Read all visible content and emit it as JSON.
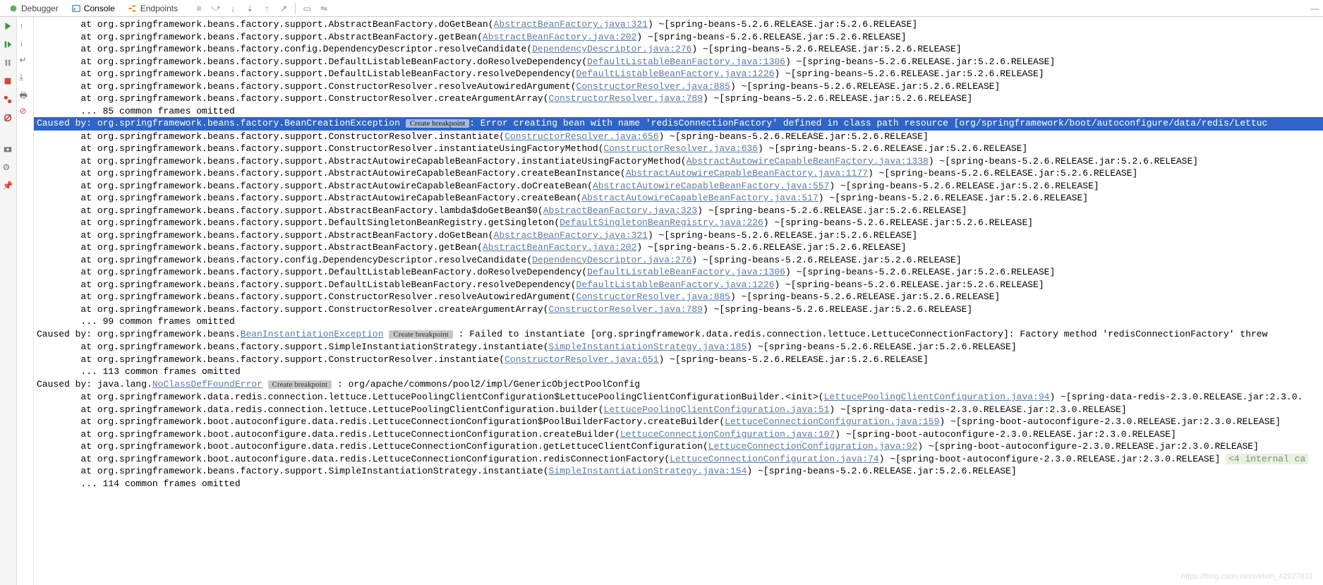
{
  "tabs": {
    "debugger": "Debugger",
    "console": "Console",
    "endpoints": "Endpoints"
  },
  "breakpoint_label": "Create breakpoint",
  "lines": [
    {
      "pre": "        at org.springframework.beans.factory.support.AbstractBeanFactory.doGetBean(",
      "link": "AbstractBeanFactory.java:321",
      "post": ") ~[spring-beans-5.2.6.RELEASE.jar:5.2.6.RELEASE]"
    },
    {
      "pre": "        at org.springframework.beans.factory.support.AbstractBeanFactory.getBean(",
      "link": "AbstractBeanFactory.java:202",
      "post": ") ~[spring-beans-5.2.6.RELEASE.jar:5.2.6.RELEASE]"
    },
    {
      "pre": "        at org.springframework.beans.factory.config.DependencyDescriptor.resolveCandidate(",
      "link": "DependencyDescriptor.java:276",
      "post": ") ~[spring-beans-5.2.6.RELEASE.jar:5.2.6.RELEASE]"
    },
    {
      "pre": "        at org.springframework.beans.factory.support.DefaultListableBeanFactory.doResolveDependency(",
      "link": "DefaultListableBeanFactory.java:1306",
      "post": ") ~[spring-beans-5.2.6.RELEASE.jar:5.2.6.RELEASE]"
    },
    {
      "pre": "        at org.springframework.beans.factory.support.DefaultListableBeanFactory.resolveDependency(",
      "link": "DefaultListableBeanFactory.java:1226",
      "post": ") ~[spring-beans-5.2.6.RELEASE.jar:5.2.6.RELEASE]"
    },
    {
      "pre": "        at org.springframework.beans.factory.support.ConstructorResolver.resolveAutowiredArgument(",
      "link": "ConstructorResolver.java:885",
      "post": ") ~[spring-beans-5.2.6.RELEASE.jar:5.2.6.RELEASE]"
    },
    {
      "pre": "        at org.springframework.beans.factory.support.ConstructorResolver.createArgumentArray(",
      "link": "ConstructorResolver.java:789",
      "post": ") ~[spring-beans-5.2.6.RELEASE.jar:5.2.6.RELEASE]"
    },
    {
      "plain": "        ... 85 common frames omitted"
    },
    {
      "hl": true,
      "pre": "Caused by: org.springframework.beans.factory.BeanCreationException",
      "bp": true,
      "post2": ": Error creating bean with name 'redisConnectionFactory' defined in class path resource [org/springframework/boot/autoconfigure/data/redis/Lettuc"
    },
    {
      "pre": "        at org.springframework.beans.factory.support.ConstructorResolver.instantiate(",
      "link": "ConstructorResolver.java:656",
      "post": ") ~[spring-beans-5.2.6.RELEASE.jar:5.2.6.RELEASE]"
    },
    {
      "pre": "        at org.springframework.beans.factory.support.ConstructorResolver.instantiateUsingFactoryMethod(",
      "link": "ConstructorResolver.java:636",
      "post": ") ~[spring-beans-5.2.6.RELEASE.jar:5.2.6.RELEASE]"
    },
    {
      "pre": "        at org.springframework.beans.factory.support.AbstractAutowireCapableBeanFactory.instantiateUsingFactoryMethod(",
      "link": "AbstractAutowireCapableBeanFactory.java:1338",
      "post": ") ~[spring-beans-5.2.6.RELEASE.jar:5.2.6.RELEASE]"
    },
    {
      "pre": "        at org.springframework.beans.factory.support.AbstractAutowireCapableBeanFactory.createBeanInstance(",
      "link": "AbstractAutowireCapableBeanFactory.java:1177",
      "post": ") ~[spring-beans-5.2.6.RELEASE.jar:5.2.6.RELEASE]"
    },
    {
      "pre": "        at org.springframework.beans.factory.support.AbstractAutowireCapableBeanFactory.doCreateBean(",
      "link": "AbstractAutowireCapableBeanFactory.java:557",
      "post": ") ~[spring-beans-5.2.6.RELEASE.jar:5.2.6.RELEASE]"
    },
    {
      "pre": "        at org.springframework.beans.factory.support.AbstractAutowireCapableBeanFactory.createBean(",
      "link": "AbstractAutowireCapableBeanFactory.java:517",
      "post": ") ~[spring-beans-5.2.6.RELEASE.jar:5.2.6.RELEASE]"
    },
    {
      "pre": "        at org.springframework.beans.factory.support.AbstractBeanFactory.lambda$doGetBean$0(",
      "link": "AbstractBeanFactory.java:323",
      "post": ") ~[spring-beans-5.2.6.RELEASE.jar:5.2.6.RELEASE]"
    },
    {
      "pre": "        at org.springframework.beans.factory.support.DefaultSingletonBeanRegistry.getSingleton(",
      "link": "DefaultSingletonBeanRegistry.java:226",
      "post": ") ~[spring-beans-5.2.6.RELEASE.jar:5.2.6.RELEASE]"
    },
    {
      "pre": "        at org.springframework.beans.factory.support.AbstractBeanFactory.doGetBean(",
      "link": "AbstractBeanFactory.java:321",
      "post": ") ~[spring-beans-5.2.6.RELEASE.jar:5.2.6.RELEASE]"
    },
    {
      "pre": "        at org.springframework.beans.factory.support.AbstractBeanFactory.getBean(",
      "link": "AbstractBeanFactory.java:202",
      "post": ") ~[spring-beans-5.2.6.RELEASE.jar:5.2.6.RELEASE]"
    },
    {
      "pre": "        at org.springframework.beans.factory.config.DependencyDescriptor.resolveCandidate(",
      "link": "DependencyDescriptor.java:276",
      "post": ") ~[spring-beans-5.2.6.RELEASE.jar:5.2.6.RELEASE]"
    },
    {
      "pre": "        at org.springframework.beans.factory.support.DefaultListableBeanFactory.doResolveDependency(",
      "link": "DefaultListableBeanFactory.java:1306",
      "post": ") ~[spring-beans-5.2.6.RELEASE.jar:5.2.6.RELEASE]"
    },
    {
      "pre": "        at org.springframework.beans.factory.support.DefaultListableBeanFactory.resolveDependency(",
      "link": "DefaultListableBeanFactory.java:1226",
      "post": ") ~[spring-beans-5.2.6.RELEASE.jar:5.2.6.RELEASE]"
    },
    {
      "pre": "        at org.springframework.beans.factory.support.ConstructorResolver.resolveAutowiredArgument(",
      "link": "ConstructorResolver.java:885",
      "post": ") ~[spring-beans-5.2.6.RELEASE.jar:5.2.6.RELEASE]"
    },
    {
      "pre": "        at org.springframework.beans.factory.support.ConstructorResolver.createArgumentArray(",
      "link": "ConstructorResolver.java:789",
      "post": ") ~[spring-beans-5.2.6.RELEASE.jar:5.2.6.RELEASE]"
    },
    {
      "plain": "        ... 99 common frames omitted"
    },
    {
      "pre": "Caused by: org.springframework.beans.",
      "link": "BeanInstantiationException",
      "bp": true,
      "post2": " : Failed to instantiate [org.springframework.data.redis.connection.lettuce.LettuceConnectionFactory]: Factory method 'redisConnectionFactory' threw"
    },
    {
      "pre": "        at org.springframework.beans.factory.support.SimpleInstantiationStrategy.instantiate(",
      "link": "SimpleInstantiationStrategy.java:185",
      "post": ") ~[spring-beans-5.2.6.RELEASE.jar:5.2.6.RELEASE]"
    },
    {
      "pre": "        at org.springframework.beans.factory.support.ConstructorResolver.instantiate(",
      "link": "ConstructorResolver.java:651",
      "post": ") ~[spring-beans-5.2.6.RELEASE.jar:5.2.6.RELEASE]"
    },
    {
      "plain": "        ... 113 common frames omitted"
    },
    {
      "pre": "Caused by: java.lang.",
      "link": "NoClassDefFoundError",
      "bp": true,
      "post2": " : org/apache/commons/pool2/impl/GenericObjectPoolConfig"
    },
    {
      "pre": "        at org.springframework.data.redis.connection.lettuce.LettucePoolingClientConfiguration$LettucePoolingClientConfigurationBuilder.<init>(",
      "link": "LettucePoolingClientConfiguration.java:94",
      "post": ") ~[spring-data-redis-2.3.0.RELEASE.jar:2.3.0."
    },
    {
      "pre": "        at org.springframework.data.redis.connection.lettuce.LettucePoolingClientConfiguration.builder(",
      "link": "LettucePoolingClientConfiguration.java:51",
      "post": ") ~[spring-data-redis-2.3.0.RELEASE.jar:2.3.0.RELEASE]"
    },
    {
      "pre": "        at org.springframework.boot.autoconfigure.data.redis.LettuceConnectionConfiguration$PoolBuilderFactory.createBuilder(",
      "link": "LettuceConnectionConfiguration.java:159",
      "post": ") ~[spring-boot-autoconfigure-2.3.0.RELEASE.jar:2.3.0.RELEASE]"
    },
    {
      "pre": "        at org.springframework.boot.autoconfigure.data.redis.LettuceConnectionConfiguration.createBuilder(",
      "link": "LettuceConnectionConfiguration.java:107",
      "post": ") ~[spring-boot-autoconfigure-2.3.0.RELEASE.jar:2.3.0.RELEASE]"
    },
    {
      "pre": "        at org.springframework.boot.autoconfigure.data.redis.LettuceConnectionConfiguration.getLettuceClientConfiguration(",
      "link": "LettuceConnectionConfiguration.java:92",
      "post": ") ~[spring-boot-autoconfigure-2.3.0.RELEASE.jar:2.3.0.RELEASE]"
    },
    {
      "pre": "        at org.springframework.boot.autoconfigure.data.redis.LettuceConnectionConfiguration.redisConnectionFactory(",
      "link": "LettuceConnectionConfiguration.java:74",
      "post": ") ~[spring-boot-autoconfigure-2.3.0.RELEASE.jar:2.3.0.RELEASE] ",
      "fold": "<4 internal ca"
    },
    {
      "pre": "        at org.springframework.beans.factory.support.SimpleInstantiationStrategy.instantiate(",
      "link": "SimpleInstantiationStrategy.java:154",
      "post": ") ~[spring-beans-5.2.6.RELEASE.jar:5.2.6.RELEASE]"
    },
    {
      "plain": "        ... 114 common frames omitted"
    }
  ],
  "watermark": "https://blog.csdn.net/weixin_42927831"
}
